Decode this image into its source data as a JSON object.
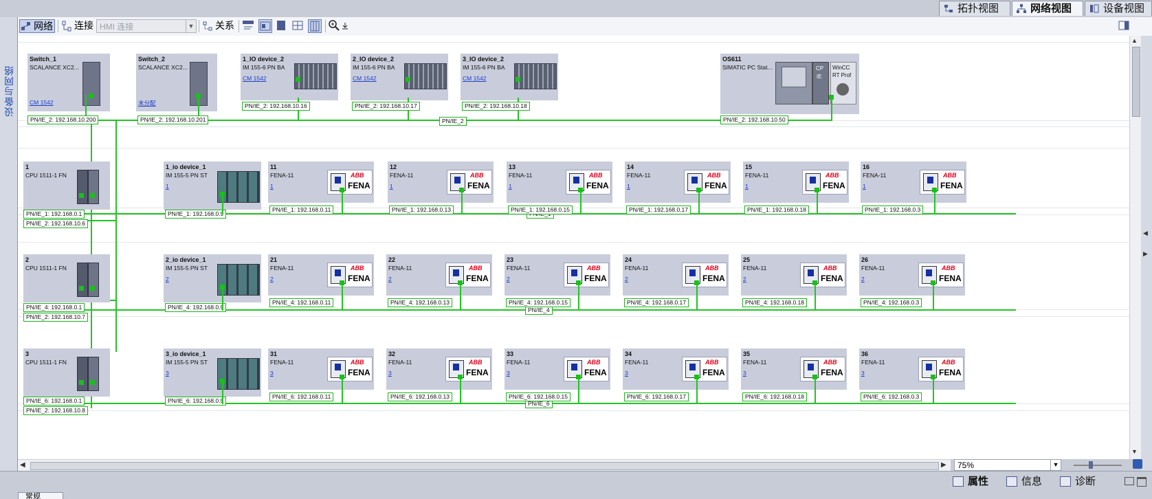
{
  "view_tabs": {
    "topology": "拓扑视图",
    "network": "网络视图",
    "device": "设备视图"
  },
  "side_tab": {
    "label": "设备与网络"
  },
  "toolbar": {
    "network": "网络",
    "connections": "连接",
    "hmi_connection_placeholder": "HMI 连接",
    "relations": "关系"
  },
  "zoom": {
    "value": "75%"
  },
  "bottom_tabs": {
    "properties": "属性",
    "info": "信息",
    "diagnostics": "诊断"
  },
  "bottom_left_tab": "常规",
  "devices": {
    "switch1": {
      "name": "Switch_1",
      "type": "SCALANCE XC2...",
      "link": "CM 1542",
      "port": "PN/IE_2:  192.168.10.200"
    },
    "switch2": {
      "name": "Switch_2",
      "type": "SCALANCE XC2...",
      "link": "未分配",
      "port": "PN/IE_2:  192.168.10.201"
    },
    "io1": {
      "name": "1_IO device_2",
      "type": "IM 155-6 PN BA",
      "link": "CM 1542",
      "port": "PN/IE_2:  192.168.10.16"
    },
    "io2": {
      "name": "2_IO device_2",
      "type": "IM 155-6 PN BA",
      "link": "CM 1542",
      "port": "PN/IE_2:  192.168.10.17"
    },
    "io3": {
      "name": "3_IO device_2",
      "type": "IM 155-6 PN BA",
      "link": "CM 1542",
      "port": "PN/IE_2:  192.168.10.18"
    },
    "os": {
      "name": "OS611",
      "type": "SIMATIC PC Stat...",
      "port": "PN/IE_2:  192.168.10.50",
      "cp": "CP",
      "ie": "IE",
      "wincc": "WinCC",
      "rtprof": "RT Prof"
    },
    "pnie2_label": "PN/IE_2"
  },
  "rows": [
    {
      "cpu": {
        "id": "1",
        "type": "CPU 1511-1 FN",
        "port1": "PN/IE_1:  192.168.0.1",
        "port2": "PN/IE_2:  192.168.10.6"
      },
      "io": {
        "name": "1_io device_1",
        "type": "IM 155-5 PN ST",
        "link": "1",
        "port": "PN/IE_1:  192.168.0.9"
      },
      "net": "PN/IE_1",
      "fenas": [
        {
          "id": "11",
          "type": "FENA-11",
          "link": "1",
          "port": "PN/IE_1:  192.168.0.11"
        },
        {
          "id": "12",
          "type": "FENA-11",
          "link": "1",
          "port": "PN/IE_1:  192.168.0.13"
        },
        {
          "id": "13",
          "type": "FENA-11",
          "link": "1",
          "port": "PN/IE_1:  192.168.0.15"
        },
        {
          "id": "14",
          "type": "FENA-11",
          "link": "1",
          "port": "PN/IE_1:  192.168.0.17"
        },
        {
          "id": "15",
          "type": "FENA-11",
          "link": "1",
          "port": "PN/IE_1:  192.168.0.18"
        },
        {
          "id": "16",
          "type": "FENA-11",
          "link": "1",
          "port": "PN/IE_1:  192.168.0.3"
        }
      ]
    },
    {
      "cpu": {
        "id": "2",
        "type": "CPU 1511-1 FN",
        "port1": "PN/IE_4:  192.168.0.1",
        "port2": "PN/IE_2:  192.168.10.7"
      },
      "io": {
        "name": "2_io device_1",
        "type": "IM 155-5 PN ST",
        "link": "2",
        "port": "PN/IE_4:  192.168.0.9"
      },
      "net": "PN/IE_4",
      "fenas": [
        {
          "id": "21",
          "type": "FENA-11",
          "link": "2",
          "port": "PN/IE_4:  192.168.0.11"
        },
        {
          "id": "22",
          "type": "FENA-11",
          "link": "2",
          "port": "PN/IE_4:  192.168.0.13"
        },
        {
          "id": "23",
          "type": "FENA-11",
          "link": "2",
          "port": "PN/IE_4:  192.168.0.15"
        },
        {
          "id": "24",
          "type": "FENA-11",
          "link": "2",
          "port": "PN/IE_4:  192.168.0.17"
        },
        {
          "id": "25",
          "type": "FENA-11",
          "link": "2",
          "port": "PN/IE_4:  192.168.0.18"
        },
        {
          "id": "26",
          "type": "FENA-11",
          "link": "2",
          "port": "PN/IE_4:  192.168.0.3"
        }
      ]
    },
    {
      "cpu": {
        "id": "3",
        "type": "CPU 1511-1 FN",
        "port1": "PN/IE_6:  192.168.0.1",
        "port2": "PN/IE_2:  192.168.10.8"
      },
      "io": {
        "name": "3_io device_1",
        "type": "IM 155-5 PN ST",
        "link": "3",
        "port": "PN/IE_6:  192.168.0.9"
      },
      "net": "PN/IE_6",
      "fenas": [
        {
          "id": "31",
          "type": "FENA-11",
          "link": "3",
          "port": "PN/IE_6:  192.168.0.11"
        },
        {
          "id": "32",
          "type": "FENA-11",
          "link": "3",
          "port": "PN/IE_6:  192.168.0.13"
        },
        {
          "id": "33",
          "type": "FENA-11",
          "link": "3",
          "port": "PN/IE_6:  192.168.0.15"
        },
        {
          "id": "34",
          "type": "FENA-11",
          "link": "3",
          "port": "PN/IE_6:  192.168.0.17"
        },
        {
          "id": "35",
          "type": "FENA-11",
          "link": "3",
          "port": "PN/IE_6:  192.168.0.18"
        },
        {
          "id": "36",
          "type": "FENA-11",
          "link": "3",
          "port": "PN/IE_6:  192.168.0.3"
        }
      ]
    }
  ],
  "fena_brand": "ABB",
  "fena_name": "FENA",
  "colors": {
    "network_line": "#22c422",
    "device_bg": "#c9ccdb",
    "link": "#1a3ecc"
  }
}
